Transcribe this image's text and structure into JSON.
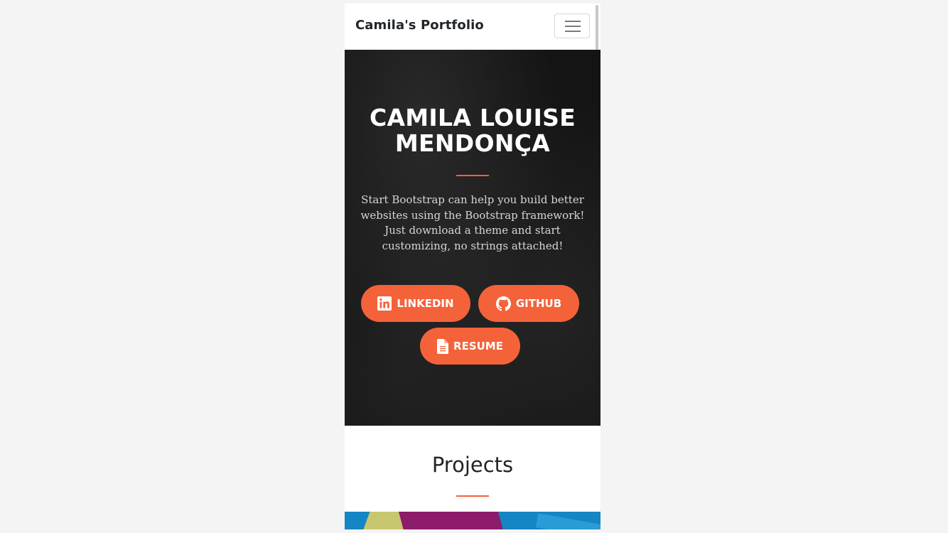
{
  "navbar": {
    "brand": "Camila's Portfolio",
    "toggler_icon": "hamburger-menu-icon"
  },
  "hero": {
    "title_line1": "CAMILA LOUISE",
    "title_line2": "MENDONÇA",
    "description": "Start Bootstrap can help you build better websites using the Bootstrap framework! Just download a theme and start customizing, no strings attached!",
    "buttons": [
      {
        "label": "LINKEDIN",
        "icon": "linkedin-icon"
      },
      {
        "label": "GITHUB",
        "icon": "github-icon"
      },
      {
        "label": "RESUME",
        "icon": "file-document-icon"
      }
    ]
  },
  "projects": {
    "title": "Projects"
  },
  "colors": {
    "accent": "#f4623a",
    "hero_background": "#141414",
    "page_background": "#f4f4f4"
  }
}
